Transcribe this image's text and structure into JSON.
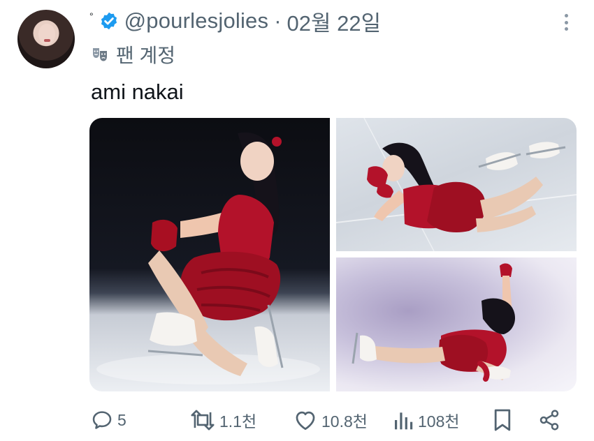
{
  "author": {
    "display_dot": "°",
    "handle": "@pourlesjolies",
    "separator": "·",
    "date": "02월 22일",
    "badge_label": "팬 계정"
  },
  "tweet": {
    "text": "ami nakai"
  },
  "media": {
    "images": [
      {
        "icon": "figure-skater-photo",
        "subject": "left"
      },
      {
        "icon": "figure-skater-photo",
        "subject": "top-right"
      },
      {
        "icon": "figure-skater-photo",
        "subject": "bottom-right"
      }
    ]
  },
  "actions": {
    "replies": "5",
    "retweets": "1.1천",
    "likes": "10.8천",
    "views": "108천"
  },
  "colors": {
    "text_primary": "#0f1419",
    "text_secondary": "#536471",
    "verified_blue": "#1d9bf0",
    "dress_red": "#b3122a"
  }
}
